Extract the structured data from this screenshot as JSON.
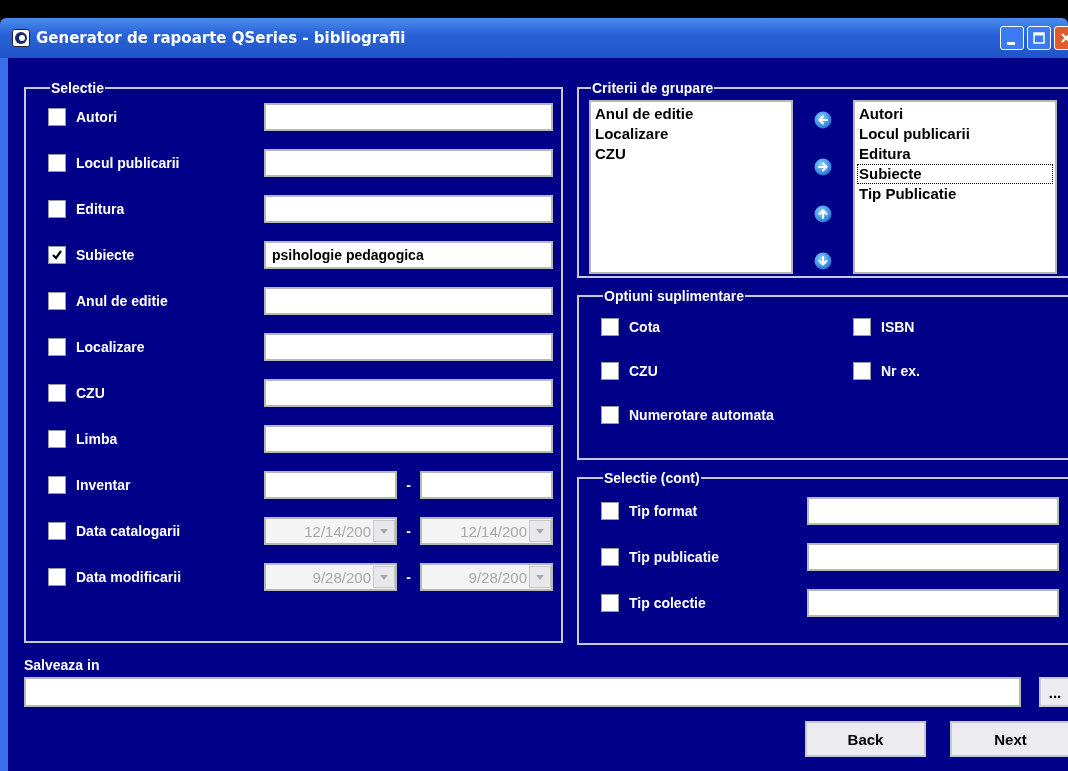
{
  "window": {
    "title": "Generator de rapoarte QSeries - bibliografii"
  },
  "selectie": {
    "legend": "Selectie",
    "rows": [
      {
        "kind": "text",
        "label": "Autori",
        "checked": false
      },
      {
        "kind": "text",
        "label": "Locul publicarii",
        "checked": false
      },
      {
        "kind": "text",
        "label": "Editura",
        "checked": false
      },
      {
        "kind": "text",
        "label": "Subiecte",
        "checked": true,
        "value": "psihologie pedagogica"
      },
      {
        "kind": "text",
        "label": "Anul de editie",
        "checked": false
      },
      {
        "kind": "text",
        "label": "Localizare",
        "checked": false
      },
      {
        "kind": "text",
        "label": "CZU",
        "checked": false
      },
      {
        "kind": "text",
        "label": "Limba",
        "checked": false
      },
      {
        "kind": "range",
        "label": "Inventar",
        "checked": false,
        "separator": "-"
      },
      {
        "kind": "date",
        "label": "Data catalogarii",
        "checked": false,
        "separator": "-",
        "from": "12/14/200",
        "to": "12/14/200",
        "disabled": true
      },
      {
        "kind": "date",
        "label": "Data modificarii",
        "checked": false,
        "separator": "-",
        "from": "9/28/200",
        "to": "9/28/200",
        "disabled": true
      }
    ]
  },
  "criterii": {
    "legend": "Criterii de grupare",
    "available": [
      {
        "label": "Anul de editie",
        "focused": false
      },
      {
        "label": "Localizare",
        "focused": false
      },
      {
        "label": "CZU",
        "focused": false
      }
    ],
    "chosen": [
      {
        "label": "Autori",
        "focused": false
      },
      {
        "label": "Locul publicarii",
        "focused": false
      },
      {
        "label": "Editura",
        "focused": false
      },
      {
        "label": "Subiecte",
        "focused": true
      },
      {
        "label": "Tip Publicatie",
        "focused": false
      }
    ]
  },
  "optiuni": {
    "legend": "Optiuni suplimentare",
    "options": [
      {
        "label": "Cota",
        "checked": false
      },
      {
        "label": "ISBN",
        "checked": false
      },
      {
        "label": "CZU",
        "checked": false
      },
      {
        "label": "Nr ex.",
        "checked": false
      },
      {
        "label": "Numerotare automata",
        "checked": false
      }
    ]
  },
  "selectie_cont": {
    "legend": "Selectie (cont)",
    "rows": [
      {
        "label": "Tip format",
        "checked": false
      },
      {
        "label": "Tip publicatie",
        "checked": false
      },
      {
        "label": "Tip colectie",
        "checked": false
      }
    ]
  },
  "save": {
    "label": "Salveaza in",
    "browse": "..."
  },
  "buttons": [
    "Back",
    "Next"
  ]
}
